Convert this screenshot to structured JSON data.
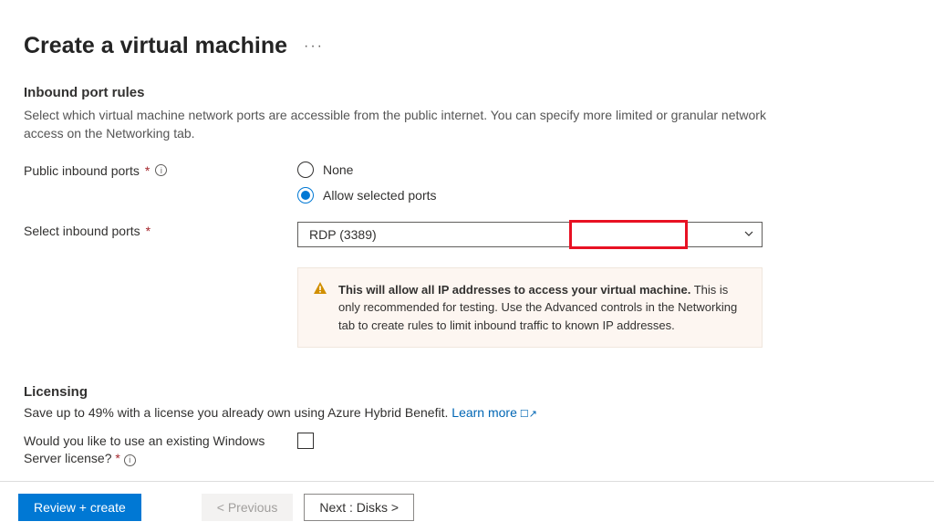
{
  "page": {
    "title": "Create a virtual machine"
  },
  "inbound": {
    "heading": "Inbound port rules",
    "description": "Select which virtual machine network ports are accessible from the public internet. You can specify more limited or granular network access on the Networking tab.",
    "public_ports_label": "Public inbound ports",
    "radio_none": "None",
    "radio_allow": "Allow selected ports",
    "select_ports_label": "Select inbound ports",
    "select_ports_value": "RDP (3389)",
    "warning_bold": "This will allow all IP addresses to access your virtual machine.",
    "warning_rest": "  This is only recommended for testing.  Use the Advanced controls in the Networking tab to create rules to limit inbound traffic to known IP addresses."
  },
  "licensing": {
    "heading": "Licensing",
    "description": "Save up to 49% with a license you already own using Azure Hybrid Benefit.  ",
    "learn_more": "Learn more",
    "question": "Would you like to use an existing Windows Server license?"
  },
  "footer": {
    "review": "Review + create",
    "previous": "< Previous",
    "next": "Next : Disks >"
  }
}
